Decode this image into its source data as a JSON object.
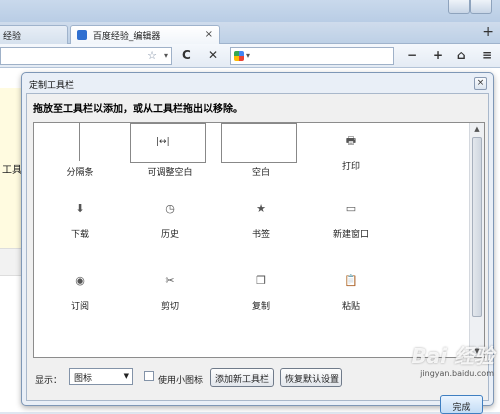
{
  "browser": {
    "tabs": [
      {
        "label": "经验",
        "close": "×"
      },
      {
        "label": "百度经验_编辑器",
        "close": "×"
      }
    ],
    "new_tab": "+",
    "nav": {
      "star": "☆",
      "drop": "▾",
      "reload": "C",
      "stop": "✕",
      "search_drop": "▾",
      "zoom_out": "−",
      "zoom_in": "+",
      "home": "⌂",
      "tools": "≡"
    },
    "page": {
      "partial_text": "工具"
    }
  },
  "dialog": {
    "title": "定制工具栏",
    "close": "×",
    "instruction": "拖放至工具栏以添加，或从工具栏拖出以移除。",
    "items": [
      {
        "label": "分隔条",
        "icon": "separator-icon",
        "glyph": ""
      },
      {
        "label": "可调整空白",
        "icon": "flexible-space-icon",
        "glyph": "|↔|"
      },
      {
        "label": "空白",
        "icon": "space-icon",
        "glyph": ""
      },
      {
        "label": "打印",
        "icon": "print-icon",
        "glyph": "🖶"
      },
      {
        "label": "下载",
        "icon": "download-icon",
        "glyph": "⬇"
      },
      {
        "label": "历史",
        "icon": "history-icon",
        "glyph": "◷"
      },
      {
        "label": "书签",
        "icon": "bookmarks-icon",
        "glyph": "★"
      },
      {
        "label": "新建窗口",
        "icon": "new-window-icon",
        "glyph": "▭"
      },
      {
        "label": "订阅",
        "icon": "feed-icon",
        "glyph": "◉"
      },
      {
        "label": "剪切",
        "icon": "cut-icon",
        "glyph": "✂"
      },
      {
        "label": "复制",
        "icon": "copy-icon",
        "glyph": "❐"
      },
      {
        "label": "粘贴",
        "icon": "paste-icon",
        "glyph": "📋"
      }
    ],
    "show_label": "显示：",
    "show_value": "图标",
    "small_icons_label": "使用小图标",
    "add_toolbar": "添加新工具栏",
    "restore_defaults": "恢复默认设置",
    "done": "完成"
  },
  "watermark": {
    "brand": "Bai 经验",
    "url": "jingyan.baidu.com"
  }
}
